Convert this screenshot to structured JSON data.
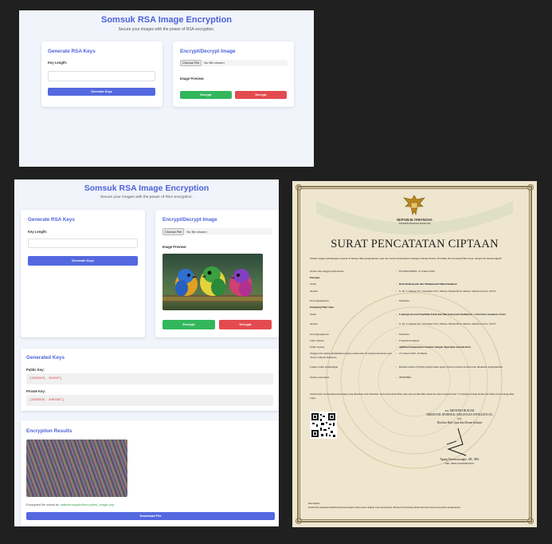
{
  "app": {
    "title": "Somsuk RSA Image Encryption",
    "subtitle": "Secure your images with the power of RSA encryption."
  },
  "generate_card": {
    "title": "Generate RSA Keys",
    "key_length_label": "Key Length:",
    "key_length_value": "",
    "button_label": "Generate Keys"
  },
  "crypt_card": {
    "title": "Encrypt/Decrypt Image",
    "choose_file_label": "Choose File",
    "no_file_text": "No file chosen",
    "preview_label": "Image Preview:",
    "encrypt_label": "Encrypt",
    "decrypt_label": "Decrypt"
  },
  "generated_keys": {
    "title": "Generated Keys",
    "public_label": "Public Key:",
    "public_value": "[2389325, 304037]",
    "private_label": "Private Key:",
    "private_value": "[2389325, 2003367]"
  },
  "results": {
    "title": "Encryption Results",
    "status_prefix": "Encrypted file saved at:",
    "status_path": "static/encrypted/encrypted_image.png",
    "download_label": "Download File"
  },
  "certificate": {
    "republic": "REPUBLIK INDONESIA",
    "ministry": "KEMENTERIAN HUKUM",
    "title": "SURAT PENCATATAN CIPTAAN",
    "intro": "Dalam rangka pelindungan ciptaan di bidang ilmu pengetahuan, seni dan sastra berdasarkan Undang-Undang Nomor 28 Tahun 2014 tentang Hak Cipta, dengan ini menerangkan:",
    "rows": [
      {
        "label": "Nomor dan tanggal permohonan",
        "value": "EC00202509085, 21 Januari 2025"
      },
      {
        "label": "Pencipta",
        "value": ""
      },
      {
        "label": "Nama",
        "value": "Dani Ruchansyah dan Muhammad Haikal Rahman"
      },
      {
        "label": "Alamat",
        "value": "Jl. Dr. T. Mansur No. 9 Kampus USU, Medan, Medan Baru, Medan, Sumatera Utara, 20155"
      },
      {
        "label": "Kewarganegaraan",
        "value": "Indonesia"
      },
      {
        "label": "Pemegang Hak Cipta",
        "value": ""
      },
      {
        "label": "Nama",
        "value": "Lembaga Inovasi Penelitian Hasil dan Hak Kekayaan Intelektual - Universitas Sumatera Utara"
      },
      {
        "label": "Alamat",
        "value": "Jl. Dr. T. Mansur No. 9 Kampus USU, Medan, Medan Baru, Medan, Sumatera Utara, 20155"
      },
      {
        "label": "Kewarganegaraan",
        "value": "Indonesia"
      },
      {
        "label": "Jenis Ciptaan",
        "value": "Program Komputer"
      },
      {
        "label": "Judul Ciptaan",
        "value": "Aplikasi Pengamanan Gambar Dengan Algoritma Somsuk-RSA"
      },
      {
        "label": "Tanggal dan tempat diumumkan untuk pertama kali di wilayah Indonesia atau di luar wilayah Indonesia",
        "value": "21 Januari 2025, di Medan"
      },
      {
        "label": "Jangka waktu pelindungan",
        "value": "Berlaku selama 50 (lima puluh) tahun sejak Ciptaan tersebut pertama kali dilakukan Pengumuman."
      },
      {
        "label": "Nomor pencatatan",
        "value": "000843866"
      }
    ],
    "closing": "adalah benar berdasarkan keterangan yang diberikan oleh Pemohon. Surat Pencatatan Hak Cipta atau produk Hak terkait ini sesuai dengan Pasal 72 Undang-Undang Nomor 28 Tahun 2014 tentang Hak Cipta.",
    "sign_1": "a.n. MENTERI HUKUM",
    "sign_2": "DIREKTUR JENDERAL KEKAYAAN INTELEKTUAL",
    "sign_3": "u.b.",
    "sign_4": "Direktur Hak Cipta dan Desain Industri",
    "signer_name": "Agung Damarsasongko, SH., MH.",
    "signer_nip": "NIP. 196912261994031001",
    "disclaimer_title": "Disclaimer:",
    "disclaimer_text": "Dalam hal pemohon memberikan keterangan tidak sesuai dengan surat pernyataan, Menteri berwenang untuk mencabut surat pencatatan permohonan."
  },
  "colors": {
    "accent": "#4d62d8",
    "encrypt": "#33b75d",
    "decrypt": "#e34a4f",
    "page_bg": "#202020",
    "certificate_bg": "#efe6cf"
  }
}
